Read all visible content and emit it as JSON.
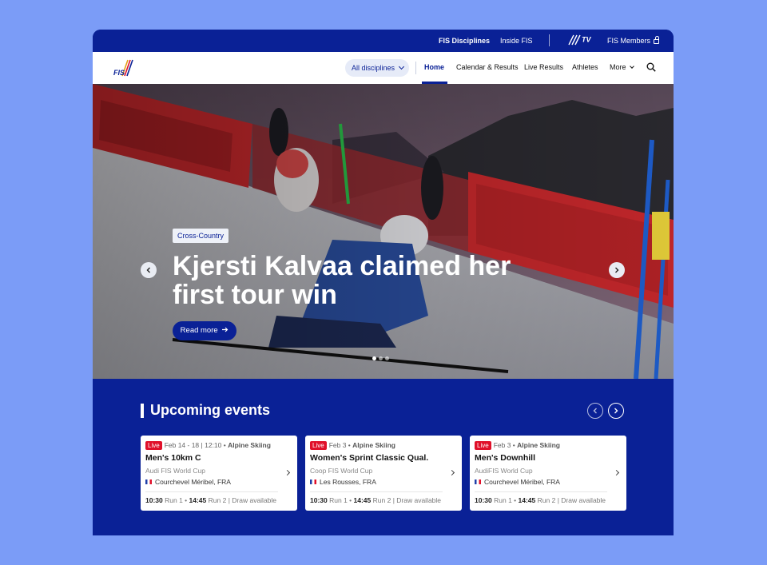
{
  "utility_bar": {
    "disciplines": "FIS Disciplines",
    "inside": "Inside FIS",
    "tv": "TV",
    "members": "FIS Members"
  },
  "nav": {
    "logo_text": "FIS",
    "disciplines_select": "All disciplines",
    "items": [
      "Home",
      "Calendar & Results",
      "Live Results",
      "Athletes",
      "More"
    ],
    "active": "Home"
  },
  "hero": {
    "tag": "Cross-Country",
    "headline": "Kjersti Kalvaa  claimed her first tour win",
    "cta": "Read more",
    "slides": 3,
    "active_slide": 1
  },
  "upcoming": {
    "title": "Upcoming events",
    "events": [
      {
        "live": "Live",
        "dates": "Feb 14 - 18",
        "time": "12:10",
        "discipline": "Alpine Skiing",
        "title": "Men's 10km C",
        "cup": "Audi FIS World Cup",
        "location": "Courchevel Méribel, FRA",
        "run1_time": "10:30",
        "run1": "Run 1",
        "run2_time": "14:45",
        "run2": "Run 2",
        "draw": "Draw available"
      },
      {
        "live": "Live",
        "dates": "Feb 3",
        "time": "",
        "discipline": "Alpine Skiing",
        "title": "Women's Sprint Classic Qual.",
        "cup": "Coop FIS World Cup",
        "location": "Les Rousses, FRA",
        "run1_time": "10:30",
        "run1": "Run 1",
        "run2_time": "14:45",
        "run2": "Run 2",
        "draw": "Draw available"
      },
      {
        "live": "Live",
        "dates": "Feb 3",
        "time": "",
        "discipline": "Alpine Skiing",
        "title": "Men's Downhill",
        "cup": "AudiFIS World Cup",
        "location": "Courchevel Méribel, FRA",
        "run1_time": "10:30",
        "run1": "Run 1",
        "run2_time": "14:45",
        "run2": "Run 2",
        "draw": "Draw available"
      }
    ]
  },
  "colors": {
    "brand_blue": "#0a2196",
    "background": "#7b9cf7",
    "live_red": "#e0102a"
  }
}
